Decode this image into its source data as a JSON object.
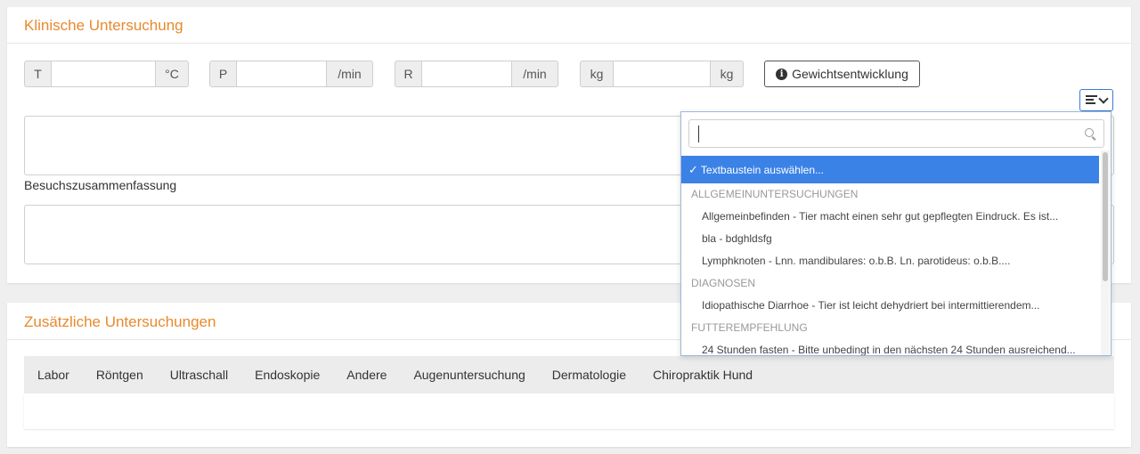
{
  "klinische": {
    "title": "Klinische Untersuchung",
    "temp_prefix": "T",
    "temp_unit": "°C",
    "pulse_prefix": "P",
    "pulse_unit": "/min",
    "resp_prefix": "R",
    "resp_unit": "/min",
    "weight_prefix": "kg",
    "weight_unit": "kg",
    "weight_button": "Gewichtsentwicklung",
    "summary_label": "Besuchszusammenfassung"
  },
  "dropdown": {
    "search_value": "",
    "selected": "Textbaustein auswählen...",
    "groups": [
      {
        "label": "ALLGEMEINUNTERSUCHUNGEN",
        "items": [
          "Allgemeinbefinden - Tier macht einen sehr gut gepflegten Eindruck. Es ist...",
          "bla - bdghldsfg",
          "Lymphknoten - Lnn. mandibulares: o.b.B. Ln. parotideus: o.b.B...."
        ]
      },
      {
        "label": "DIAGNOSEN",
        "items": [
          "Idiopathische Diarrhoe - Tier ist leicht dehydriert bei intermittierendem..."
        ]
      },
      {
        "label": "FUTTEREMPFEHLUNG",
        "items": [
          "24 Stunden fasten - Bitte unbedingt in den nächsten 24 Stunden ausreichend..."
        ]
      }
    ]
  },
  "zusaetzliche": {
    "title": "Zusätzliche Untersuchungen",
    "tabs": [
      "Labor",
      "Röntgen",
      "Ultraschall",
      "Endoskopie",
      "Andere",
      "Augenuntersuchung",
      "Dermatologie",
      "Chiropraktik Hund"
    ]
  },
  "colors": {
    "accent": "#e8892c",
    "selection": "#3b82e6"
  },
  "icons": {
    "info": "info-circle-icon",
    "template": "align-left-icon",
    "search": "search-icon",
    "check": "check-icon"
  }
}
